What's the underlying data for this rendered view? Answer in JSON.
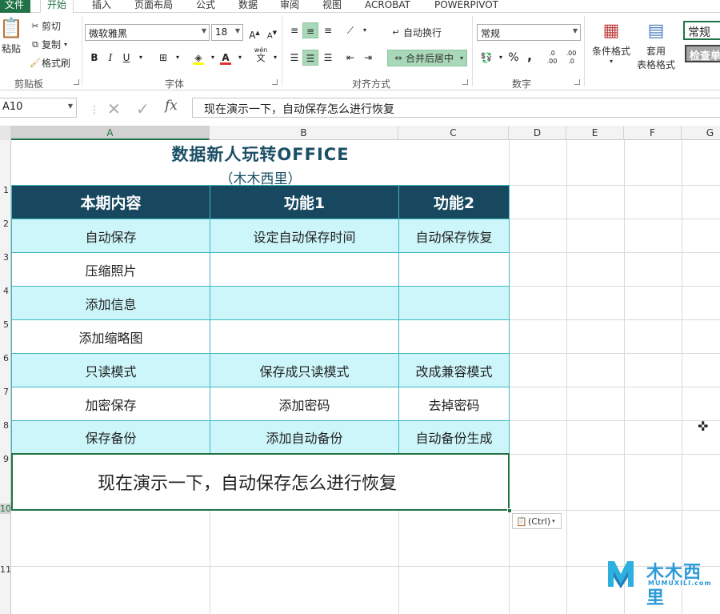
{
  "ribbon_tabs": [
    "文件",
    "开始",
    "插入",
    "页面布局",
    "公式",
    "数据",
    "审阅",
    "视图",
    "ACROBAT",
    "POWERPIVOT"
  ],
  "active_tab": "开始",
  "clipboard": {
    "paste_label": "粘贴",
    "cut_label": "剪切",
    "copy_label": "复制",
    "format_painter_label": "格式刷",
    "group_label": "剪贴板"
  },
  "font": {
    "name": "微软雅黑",
    "size": "18",
    "grow": "A",
    "shrink": "A",
    "bold": "B",
    "italic": "I",
    "underline": "U",
    "group_label": "字体",
    "pinyin_top": "wén",
    "pinyin_bottom": "文"
  },
  "alignment": {
    "wrap_label": "自动换行",
    "merge_label": "合并后居中",
    "group_label": "对齐方式"
  },
  "number": {
    "format": "常规",
    "percent": "%",
    "comma": ",",
    "group_label": "数字"
  },
  "styles": {
    "conditional_label": "条件格式",
    "table_label_1": "套用",
    "table_label_2": "表格格式",
    "style_normal": "常规",
    "style_check": "检查单"
  },
  "formula_bar": {
    "cell_ref": "A10",
    "fx": "fx",
    "cancel": "✕",
    "enter": "✓",
    "content": "现在演示一下，自动保存怎么进行恢复"
  },
  "columns": [
    "A",
    "B",
    "C",
    "D",
    "E",
    "F",
    "G"
  ],
  "rows": [
    "1",
    "2",
    "3",
    "4",
    "5",
    "6",
    "7",
    "8",
    "9",
    "10",
    "11"
  ],
  "sheet": {
    "title": "数据新人玩转OFFICE",
    "subtitle": "（木木西里）",
    "headers": [
      "本期内容",
      "功能1",
      "功能2"
    ],
    "table": [
      [
        "自动保存",
        "设定自动保存时间",
        "自动保存恢复"
      ],
      [
        "压缩照片",
        "",
        ""
      ],
      [
        "添加信息",
        "",
        ""
      ],
      [
        "添加缩略图",
        "",
        ""
      ],
      [
        "只读模式",
        "保存成只读模式",
        "改成兼容模式"
      ],
      [
        "加密保存",
        "添加密码",
        "去掉密码"
      ],
      [
        "保存备份",
        "添加自动备份",
        "自动备份生成"
      ]
    ],
    "a10": "现在演示一下，自动保存怎么进行恢复"
  },
  "paste_options": "(Ctrl)",
  "watermark": {
    "name": "木木西里",
    "url": "MUMUXILI.com"
  },
  "colors": {
    "excel_green": "#217346",
    "header_navy": "#17485f",
    "row_cyan": "#ccf6fa",
    "border_teal": "#3fb7c2",
    "logo_blue": "#2b9ad6"
  }
}
